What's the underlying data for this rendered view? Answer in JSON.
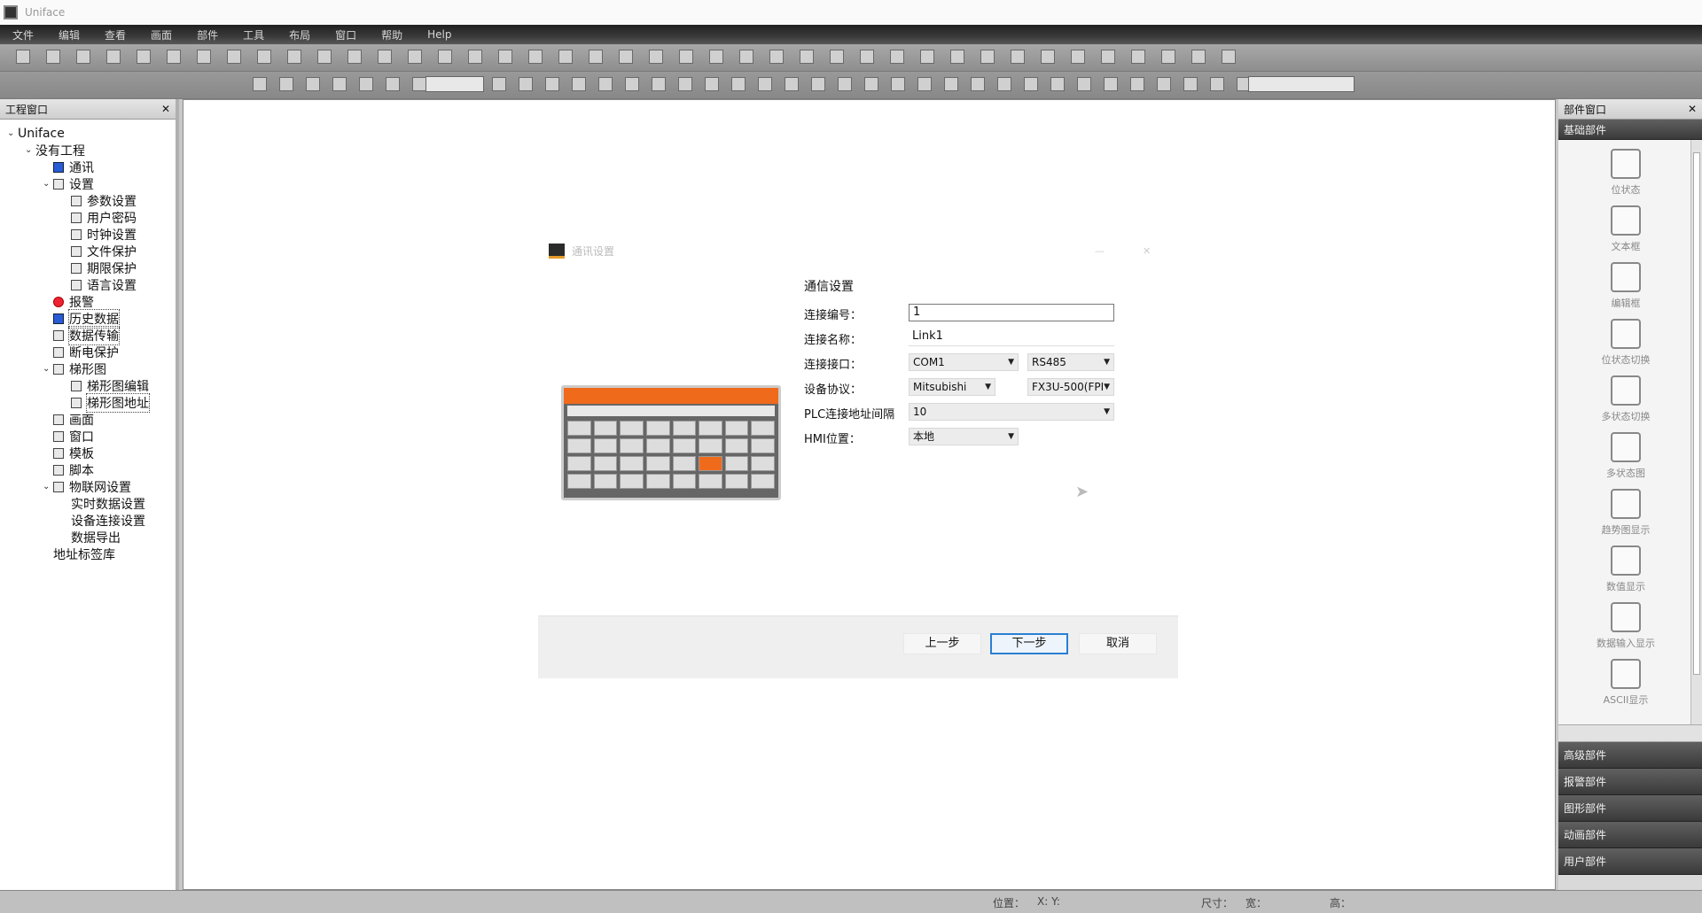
{
  "window": {
    "title": "Uniface"
  },
  "menu": [
    "文件",
    "编辑",
    "查看",
    "画面",
    "部件",
    "工具",
    "布局",
    "窗口",
    "帮助",
    "Help"
  ],
  "left_panel": {
    "title": "工程窗口",
    "tree": [
      {
        "label": "Uniface",
        "level": 0,
        "toggle": "v",
        "icon": "none"
      },
      {
        "label": "没有工程",
        "level": 1,
        "toggle": "v",
        "icon": "none"
      },
      {
        "label": "通讯",
        "level": 2,
        "toggle": "",
        "icon": "blue"
      },
      {
        "label": "设置",
        "level": 2,
        "toggle": "v",
        "icon": "gear"
      },
      {
        "label": "参数设置",
        "level": 3,
        "toggle": "",
        "icon": "tool"
      },
      {
        "label": "用户密码",
        "level": 3,
        "toggle": "",
        "icon": "box"
      },
      {
        "label": "时钟设置",
        "level": 3,
        "toggle": "",
        "icon": "clock"
      },
      {
        "label": "文件保护",
        "level": 3,
        "toggle": "",
        "icon": "box"
      },
      {
        "label": "期限保护",
        "level": 3,
        "toggle": "",
        "icon": "clock"
      },
      {
        "label": "语言设置",
        "level": 3,
        "toggle": "",
        "icon": "pin"
      },
      {
        "label": "报警",
        "level": 2,
        "toggle": "",
        "icon": "red"
      },
      {
        "label": "历史数据",
        "level": 2,
        "toggle": "",
        "icon": "blue"
      },
      {
        "label": "数据传输",
        "level": 2,
        "toggle": "",
        "icon": "box"
      },
      {
        "label": "断电保护",
        "level": 2,
        "toggle": "",
        "icon": "box"
      },
      {
        "label": "梯形图",
        "level": 2,
        "toggle": "v",
        "icon": "box"
      },
      {
        "label": "梯形图编辑",
        "level": 3,
        "toggle": "",
        "icon": "box"
      },
      {
        "label": "梯形图地址",
        "level": 3,
        "toggle": "",
        "icon": "box"
      },
      {
        "label": "画面",
        "level": 2,
        "toggle": "",
        "icon": "box"
      },
      {
        "label": "窗口",
        "level": 2,
        "toggle": "",
        "icon": "box"
      },
      {
        "label": "模板",
        "level": 2,
        "toggle": "",
        "icon": "box"
      },
      {
        "label": "脚本",
        "level": 2,
        "toggle": "",
        "icon": "box"
      },
      {
        "label": "物联网设置",
        "level": 2,
        "toggle": "v",
        "icon": "box"
      },
      {
        "label": "实时数据设置",
        "level": 3,
        "toggle": "",
        "icon": "none"
      },
      {
        "label": "设备连接设置",
        "level": 3,
        "toggle": "",
        "icon": "none"
      },
      {
        "label": "数据导出",
        "level": 3,
        "toggle": "",
        "icon": "none"
      },
      {
        "label": "地址标签库",
        "level": 2,
        "toggle": "",
        "icon": "none"
      }
    ]
  },
  "right_panel": {
    "title": "部件窗口",
    "category_open": "基础部件",
    "parts": [
      "位状态",
      "文本框",
      "编辑框",
      "位状态切换",
      "多状态切换",
      "多状态图",
      "趋势图显示",
      "数值显示",
      "数据输入显示",
      "ASCII显示"
    ],
    "categories_bottom": [
      "高级部件",
      "报警部件",
      "图形部件",
      "动画部件",
      "用户部件"
    ]
  },
  "dialog": {
    "title": "通讯设置",
    "section": "通信设置",
    "fields": {
      "link_no_label": "连接编号：",
      "link_no_value": "1",
      "link_name_label": "连接名称：",
      "link_name_value": "Link1",
      "port_label": "连接接口：",
      "port_value": "COM1",
      "port_type": "RS485",
      "protocol_label": "设备协议：",
      "protocol_vendor": "Mitsubishi",
      "protocol_model": "FX3U-500(FPI",
      "plc_addr_label": "PLC连接地址间隔",
      "plc_addr_value": "10",
      "hmi_pos_label": "HMI位置：",
      "hmi_pos_value": "本地"
    },
    "buttons": {
      "prev": "上一步",
      "next": "下一步",
      "cancel": "取消"
    }
  },
  "status": {
    "seg1": "位置：",
    "seg2": "X: Y:",
    "seg3": "尺寸：",
    "seg4": "宽：",
    "seg5": "高："
  }
}
